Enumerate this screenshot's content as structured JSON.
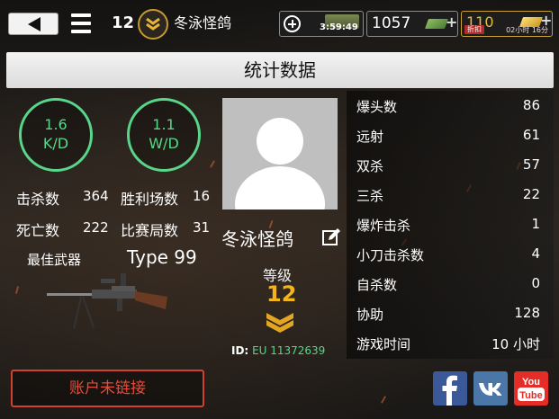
{
  "topbar": {
    "player_level": "12",
    "player_name": "冬泳怪鸽",
    "timer": "3:59:49",
    "cash": "1057",
    "gold": "110",
    "sale_tag": "折扣",
    "sale_time": "02小时 16分"
  },
  "title": "统计数据",
  "left": {
    "kd": {
      "value": "1.6",
      "label": "K/D"
    },
    "wd": {
      "value": "1.1",
      "label": "W/D"
    },
    "stats": [
      {
        "label": "击杀数",
        "value": "364"
      },
      {
        "label": "胜利场数",
        "value": "16"
      },
      {
        "label": "死亡数",
        "value": "222"
      },
      {
        "label": "比赛局数",
        "value": "31"
      }
    ],
    "best_weapon_label": "最佳武器",
    "best_weapon_name": "Type 99"
  },
  "profile": {
    "name": "冬泳怪鸽",
    "level_label": "等级",
    "level_value": "12",
    "id_label": "ID:",
    "id_value": "EU 11372639"
  },
  "right_stats": [
    {
      "label": "爆头数",
      "value": "86"
    },
    {
      "label": "远射",
      "value": "61"
    },
    {
      "label": "双杀",
      "value": "57"
    },
    {
      "label": "三杀",
      "value": "22"
    },
    {
      "label": "爆炸击杀",
      "value": "1"
    },
    {
      "label": "小刀击杀数",
      "value": "4"
    },
    {
      "label": "自杀数",
      "value": "0"
    },
    {
      "label": "协助",
      "value": "128"
    },
    {
      "label": "游戏时间",
      "value": "10 小时"
    }
  ],
  "bottom": {
    "link_button": "账户未链接"
  },
  "colors": {
    "green": "#58d78a",
    "gold": "#f3b51f",
    "red": "#d2412f"
  },
  "icons": [
    "back-arrow-icon",
    "menu-icon",
    "rank-chevron-icon",
    "plus-icon",
    "crate-icon",
    "cash-icon",
    "gold-icon",
    "edit-icon",
    "facebook-icon",
    "vk-icon",
    "youtube-icon"
  ]
}
